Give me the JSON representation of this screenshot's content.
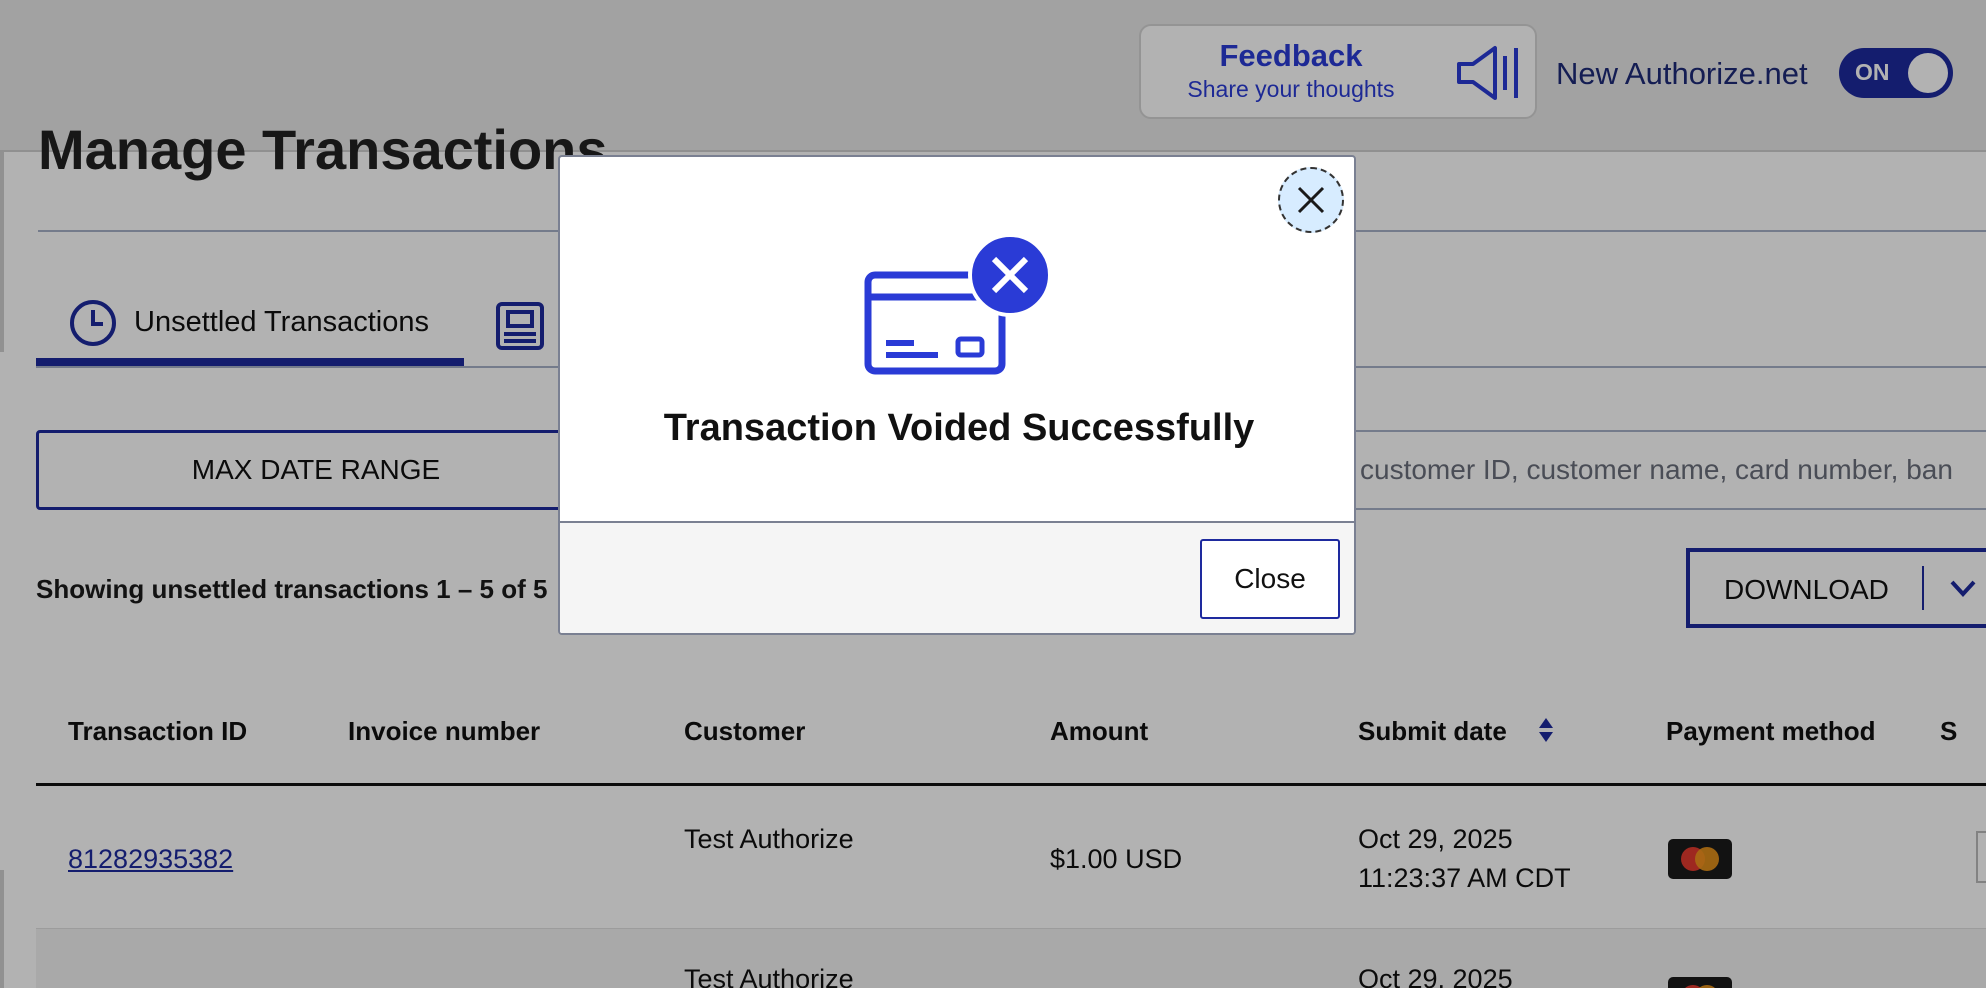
{
  "header": {
    "feedback_title": "Feedback",
    "feedback_subtitle": "Share your thoughts",
    "new_authorize_label": "New Authorize.net",
    "toggle_label": "ON"
  },
  "page": {
    "title": "Manage Transactions"
  },
  "tabs": [
    {
      "label": "Unsettled Transactions",
      "active": true
    }
  ],
  "filters": {
    "date_range_label": "MAX DATE RANGE",
    "search_placeholder": "customer ID, customer name, card number, ban"
  },
  "results": {
    "showing_text": "Showing unsettled transactions  1 – 5 of 5",
    "download_label": "DOWNLOAD"
  },
  "table": {
    "headers": [
      "Transaction ID",
      "Invoice number",
      "Customer",
      "Amount",
      "Submit date",
      "Payment method",
      "S"
    ],
    "rows": [
      {
        "transaction_id": "81282935382",
        "invoice": "",
        "customer": "Test Authorize",
        "amount": "$1.00 USD",
        "date": "Oct 29, 2025",
        "time": "11:23:37 AM CDT"
      },
      {
        "transaction_id": "",
        "invoice": "",
        "customer": "Test Authorize",
        "amount": "$",
        "date": "Oct 29, 2025",
        "time": ""
      }
    ]
  },
  "modal": {
    "title": "Transaction Voided Successfully",
    "close_label": "Close"
  },
  "colors": {
    "brand_blue": "#1e2a9e",
    "feedback_blue": "#2a3bd6",
    "close_hover": "#d7ecff"
  }
}
